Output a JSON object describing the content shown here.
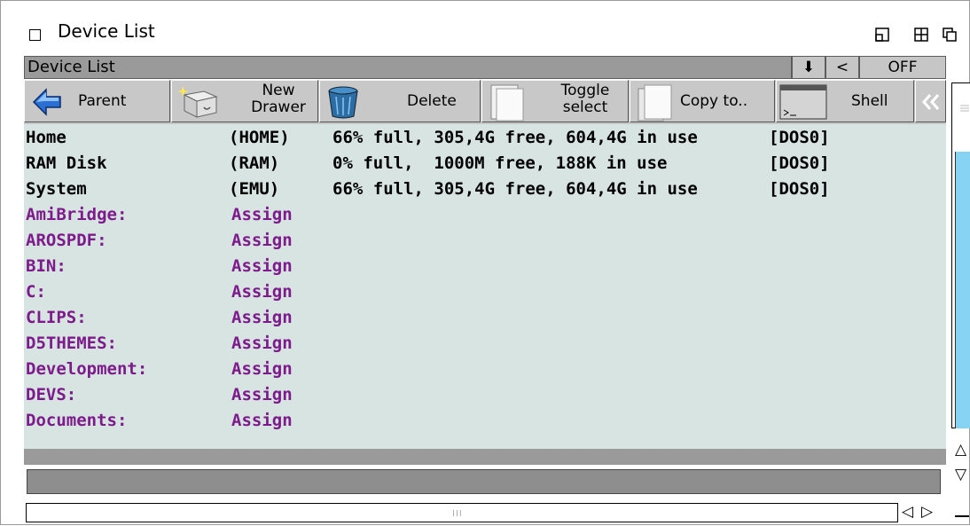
{
  "window": {
    "title": "Device List"
  },
  "lister": {
    "title": "Device List",
    "buttons": [
      "⬇",
      "<",
      "OFF"
    ]
  },
  "toolbar": {
    "parent": "Parent",
    "new_drawer_line1": "New",
    "new_drawer_line2": "Drawer",
    "delete": "Delete",
    "toggle_line1": "Toggle",
    "toggle_line2": "select",
    "copy": "Copy to..",
    "shell": "Shell"
  },
  "devices": [
    {
      "name": "Home",
      "volume": "(HOME)",
      "info": "66% full, 305,4G free, 604,4G in use",
      "handler": "[DOS0]",
      "kind": "device"
    },
    {
      "name": "RAM Disk",
      "volume": "(RAM)",
      "info": "0% full,  1000M free, 188K in use",
      "handler": "[DOS0]",
      "kind": "device"
    },
    {
      "name": "System",
      "volume": "(EMU)",
      "info": "66% full, 305,4G free, 604,4G in use",
      "handler": "[DOS0]",
      "kind": "device"
    },
    {
      "name": "AmiBridge:",
      "volume": "Assign",
      "kind": "assign"
    },
    {
      "name": "AROSPDF:",
      "volume": "Assign",
      "kind": "assign"
    },
    {
      "name": "BIN:",
      "volume": "Assign",
      "kind": "assign"
    },
    {
      "name": "C:",
      "volume": "Assign",
      "kind": "assign"
    },
    {
      "name": "CLIPS:",
      "volume": "Assign",
      "kind": "assign"
    },
    {
      "name": "D5THEMES:",
      "volume": "Assign",
      "kind": "assign"
    },
    {
      "name": "Development:",
      "volume": "Assign",
      "kind": "assign"
    },
    {
      "name": "DEVS:",
      "volume": "Assign",
      "kind": "assign"
    },
    {
      "name": "Documents:",
      "volume": "Assign",
      "kind": "assign"
    }
  ],
  "hscroll": {
    "knob_glyph": "III"
  },
  "colors": {
    "list_bg": "#d7e4e1",
    "assign_text": "#7d1a8c",
    "scroll_knob": "#87d3f4"
  }
}
